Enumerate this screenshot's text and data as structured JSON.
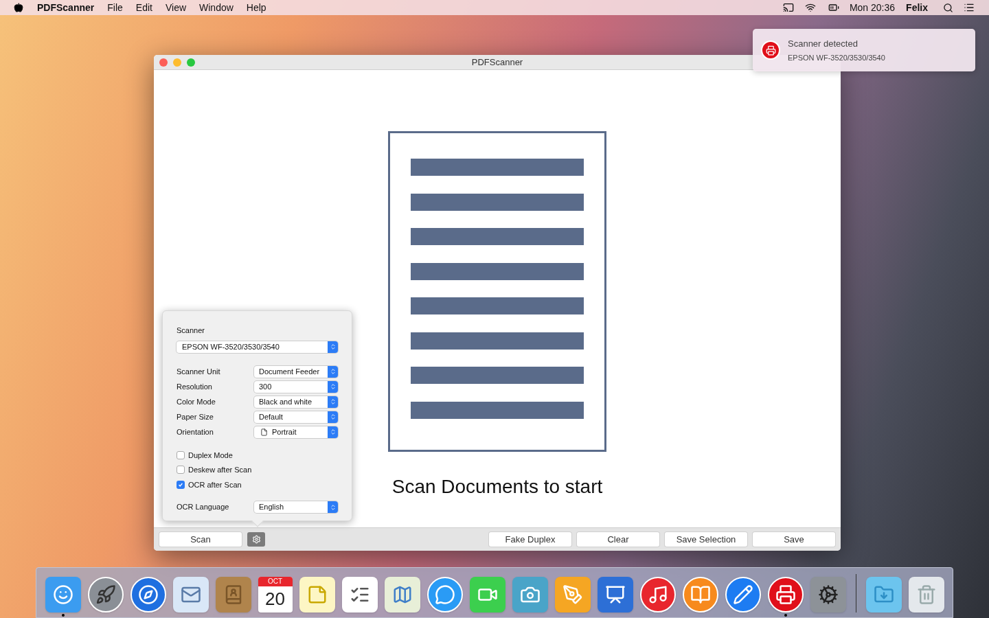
{
  "menu_bar": {
    "app_name": "PDFScanner",
    "menus": [
      "File",
      "Edit",
      "View",
      "Window",
      "Help"
    ],
    "clock": "Mon 20:36",
    "user": "Felix"
  },
  "notification": {
    "title": "Scanner detected",
    "body": "EPSON WF-3520/3530/3540"
  },
  "window": {
    "title": "PDFScanner",
    "message": "Scan Documents to start",
    "scan_button": "Scan",
    "toolbar_buttons": [
      "Fake Duplex",
      "Clear",
      "Save Selection",
      "Save"
    ]
  },
  "settings": {
    "scanner_label": "Scanner",
    "scanner_value": "EPSON WF-3520/3530/3540",
    "fields": [
      {
        "label": "Scanner Unit",
        "value": "Document Feeder",
        "kind": "select"
      },
      {
        "label": "Resolution",
        "value": "300",
        "kind": "select"
      },
      {
        "label": "Color Mode",
        "value": "Black and white",
        "kind": "select"
      },
      {
        "label": "Paper Size",
        "value": "Default",
        "kind": "select"
      },
      {
        "label": "Orientation",
        "value": "Portrait",
        "kind": "orientation"
      }
    ],
    "checkboxes": [
      {
        "label": "Duplex Mode",
        "checked": false
      },
      {
        "label": "Deskew after Scan",
        "checked": false
      },
      {
        "label": "OCR after Scan",
        "checked": true
      }
    ],
    "ocr_label": "OCR Language",
    "ocr_value": "English"
  },
  "dock": {
    "items": [
      {
        "kind": "finder",
        "running": true
      },
      {
        "kind": "launchpad",
        "running": false
      },
      {
        "kind": "safari",
        "running": false
      },
      {
        "kind": "mail",
        "running": false
      },
      {
        "kind": "contacts",
        "running": false
      },
      {
        "kind": "calendar",
        "running": false,
        "month": "OCT",
        "day": "20"
      },
      {
        "kind": "notes",
        "running": false
      },
      {
        "kind": "reminders",
        "running": false
      },
      {
        "kind": "maps",
        "running": false
      },
      {
        "kind": "messages",
        "running": false
      },
      {
        "kind": "facetime",
        "running": false
      },
      {
        "kind": "photos",
        "running": false
      },
      {
        "kind": "pages",
        "running": false
      },
      {
        "kind": "keynote",
        "running": false
      },
      {
        "kind": "music",
        "running": false
      },
      {
        "kind": "books",
        "running": false
      },
      {
        "kind": "appstore",
        "running": false
      },
      {
        "kind": "scanner",
        "running": true
      },
      {
        "kind": "preferences",
        "running": false
      },
      {
        "kind": "separator",
        "running": false
      },
      {
        "kind": "downloads",
        "running": false
      },
      {
        "kind": "trash",
        "running": false
      }
    ]
  }
}
